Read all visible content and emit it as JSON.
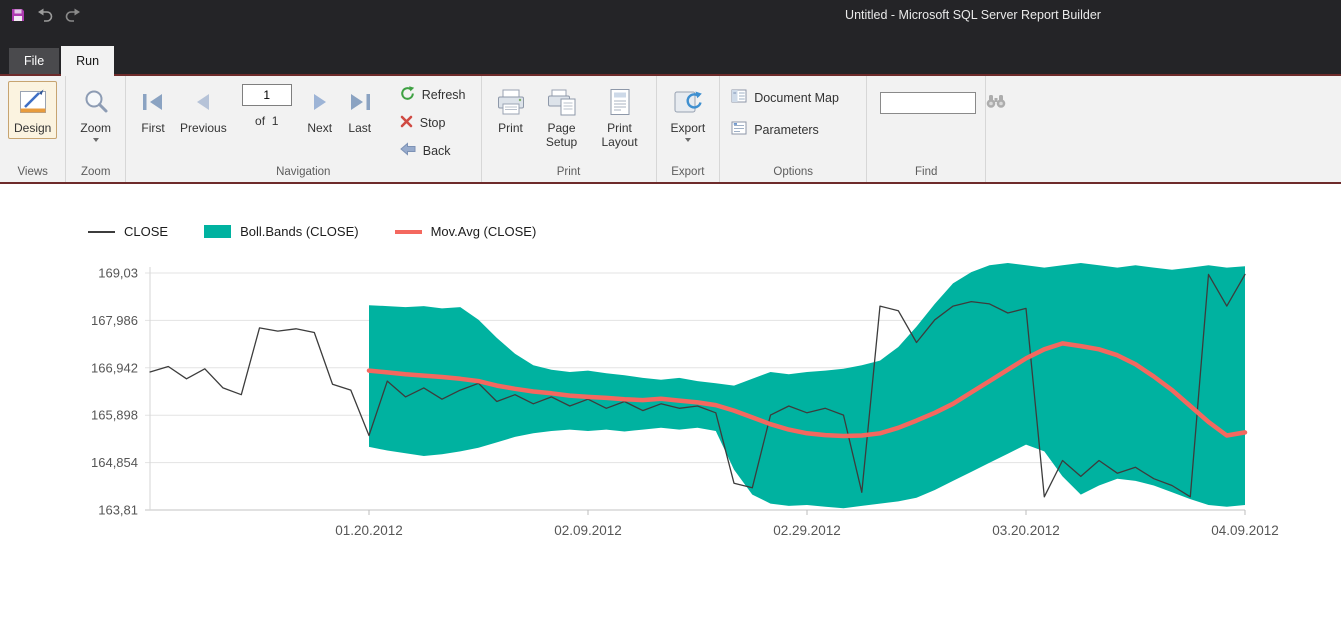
{
  "window": {
    "title": "Untitled - Microsoft SQL Server Report Builder"
  },
  "tabs": {
    "file": "File",
    "run": "Run"
  },
  "ribbon": {
    "views": {
      "design": "Design",
      "group": "Views"
    },
    "zoom": {
      "zoom": "Zoom",
      "group": "Zoom"
    },
    "navigation": {
      "first": "First",
      "previous": "Previous",
      "page_value": "1",
      "of": "of  1",
      "next": "Next",
      "last": "Last",
      "refresh": "Refresh",
      "stop": "Stop",
      "back": "Back",
      "group": "Navigation"
    },
    "print": {
      "print": "Print",
      "page_setup": "Page Setup",
      "print_layout": "Print Layout",
      "group": "Print"
    },
    "export": {
      "export": "Export",
      "group": "Export"
    },
    "options": {
      "document_map": "Document Map",
      "parameters": "Parameters",
      "group": "Options"
    },
    "find": {
      "value": "",
      "group": "Find"
    }
  },
  "ui_colors": {
    "titlebar": "#242427",
    "accent_line": "#6e2b2b",
    "ribbon": "#f2f2f2",
    "band_teal": "#00B2A0",
    "movavg_red": "#F4685F",
    "close_line": "#3c3c3c"
  },
  "chart_data": {
    "type": "line",
    "legend": [
      {
        "label": "CLOSE",
        "color": "#3c3c3c",
        "marker": "line"
      },
      {
        "label": "Boll.Bands (CLOSE)",
        "color": "#00B2A0",
        "marker": "area"
      },
      {
        "label": "Mov.Avg (CLOSE)",
        "color": "#F4685F",
        "marker": "thick-line"
      }
    ],
    "ylim": [
      163.81,
      169.03
    ],
    "y_values": [
      169.03,
      167.986,
      166.942,
      165.898,
      164.854,
      163.81
    ],
    "y_ticks": [
      "169,03",
      "167,986",
      "166,942",
      "165,898",
      "164,854",
      "163,81"
    ],
    "x_tick_labels": [
      "01.20.2012",
      "02.09.2012",
      "02.29.2012",
      "03.20.2012",
      "04.09.2012"
    ],
    "x_tick_indices": [
      12,
      24,
      36,
      48,
      60
    ],
    "n_points": 61,
    "grid": true,
    "legend_position": "top-left",
    "series": [
      {
        "name": "CLOSE",
        "type": "line",
        "color": "#3c3c3c",
        "width": 1.3,
        "start_index": 0,
        "values": [
          166.85,
          166.97,
          166.7,
          166.92,
          166.5,
          166.35,
          167.82,
          167.75,
          167.8,
          167.72,
          166.58,
          166.45,
          165.45,
          166.65,
          166.3,
          166.5,
          166.25,
          166.45,
          166.6,
          166.2,
          166.35,
          166.15,
          166.3,
          166.1,
          166.25,
          166.05,
          166.2,
          166.0,
          166.15,
          166.05,
          166.1,
          165.95,
          164.4,
          164.3,
          165.9,
          166.1,
          165.95,
          166.05,
          165.9,
          164.2,
          168.3,
          168.2,
          167.5,
          168.0,
          168.3,
          168.4,
          168.35,
          168.15,
          168.25,
          164.1,
          164.9,
          164.55,
          164.9,
          164.62,
          164.75,
          164.5,
          164.35,
          164.1,
          169.0,
          168.3,
          169.0
        ]
      },
      {
        "name": "Mov.Avg (CLOSE)",
        "type": "line",
        "color": "#F4685F",
        "width": 4.5,
        "start_index": 12,
        "values": [
          166.88,
          166.84,
          166.8,
          166.77,
          166.74,
          166.7,
          166.65,
          166.55,
          166.48,
          166.42,
          166.38,
          166.33,
          166.3,
          166.28,
          166.25,
          166.23,
          166.26,
          166.22,
          166.18,
          166.12,
          166.0,
          165.85,
          165.7,
          165.58,
          165.5,
          165.46,
          165.44,
          165.45,
          165.5,
          165.62,
          165.78,
          165.95,
          166.15,
          166.4,
          166.65,
          166.9,
          167.15,
          167.35,
          167.48,
          167.42,
          167.35,
          167.22,
          167.02,
          166.75,
          166.45,
          166.1,
          165.75,
          165.45,
          165.52
        ]
      },
      {
        "name": "Boll.Bands (CLOSE)",
        "type": "band",
        "color": "#00B2A0",
        "start_index": 12,
        "upper": [
          168.32,
          168.3,
          168.28,
          168.3,
          168.25,
          168.28,
          168.0,
          167.6,
          167.25,
          167.0,
          166.9,
          166.85,
          166.88,
          166.82,
          166.78,
          166.72,
          166.68,
          166.72,
          166.65,
          166.6,
          166.55,
          166.7,
          166.85,
          166.8,
          166.85,
          166.88,
          166.92,
          167.0,
          167.1,
          167.4,
          167.85,
          168.35,
          168.8,
          169.05,
          169.2,
          169.25,
          169.2,
          169.15,
          169.2,
          169.25,
          169.2,
          169.15,
          169.2,
          169.15,
          169.1,
          169.15,
          169.2,
          169.15,
          169.18
        ],
        "lower": [
          165.2,
          165.12,
          165.06,
          165.0,
          165.04,
          165.1,
          165.18,
          165.3,
          165.42,
          165.5,
          165.55,
          165.58,
          165.55,
          165.58,
          165.54,
          165.58,
          165.62,
          165.58,
          165.62,
          165.55,
          164.7,
          164.15,
          163.95,
          163.9,
          163.92,
          163.88,
          163.85,
          163.9,
          163.95,
          164.0,
          164.08,
          164.25,
          164.45,
          164.65,
          164.85,
          165.05,
          165.25,
          165.1,
          164.55,
          164.15,
          164.35,
          164.5,
          164.45,
          164.35,
          164.2,
          164.05,
          163.92,
          163.88,
          163.92
        ]
      }
    ]
  }
}
